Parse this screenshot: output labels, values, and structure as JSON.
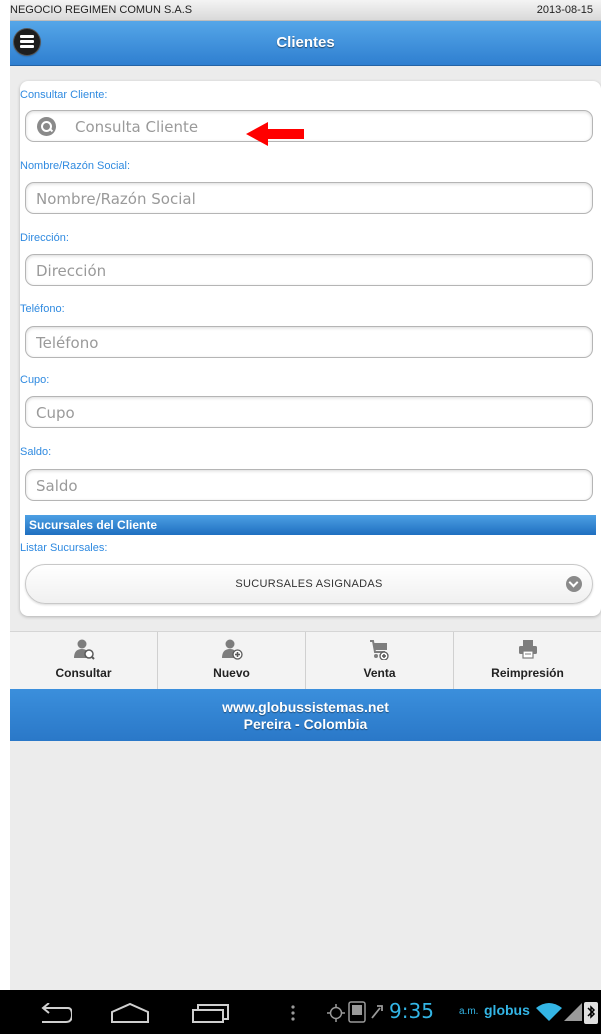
{
  "status_bar": {
    "company": "NEGOCIO REGIMEN COMUN S.A.S",
    "date": "2013-08-15"
  },
  "header": {
    "title": "Clientes",
    "menu_icon": "menu-icon"
  },
  "form": {
    "consultar": {
      "label": "Consultar Cliente:",
      "placeholder": "Consulta Cliente"
    },
    "nombre": {
      "label": "Nombre/Razón Social:",
      "placeholder": "Nombre/Razón Social"
    },
    "direccion": {
      "label": "Dirección:",
      "placeholder": "Dirección"
    },
    "telefono": {
      "label": "Teléfono:",
      "placeholder": "Teléfono"
    },
    "cupo": {
      "label": "Cupo:",
      "placeholder": "Cupo"
    },
    "saldo": {
      "label": "Saldo:",
      "placeholder": "Saldo"
    }
  },
  "sucursales": {
    "section_title": "Sucursales del Cliente",
    "list_label": "Listar Sucursales:",
    "select_value": "SUCURSALES ASIGNADAS"
  },
  "nav": {
    "items": [
      {
        "label": "Consultar",
        "icon": "user-search-icon"
      },
      {
        "label": "Nuevo",
        "icon": "user-add-icon"
      },
      {
        "label": "Venta",
        "icon": "cart-icon"
      },
      {
        "label": "Reimpresión",
        "icon": "printer-icon"
      }
    ]
  },
  "footer": {
    "line1": "www.globussistemas.net",
    "line2": "Pereira - Colombia"
  },
  "system_bar": {
    "time": "9:35",
    "ampm": "a.m.",
    "carrier": "globus"
  },
  "colors": {
    "accent": "#2f8ae0",
    "header": "#3a8ad8",
    "arrow": "#ff0000",
    "clock": "#33b5e5"
  }
}
